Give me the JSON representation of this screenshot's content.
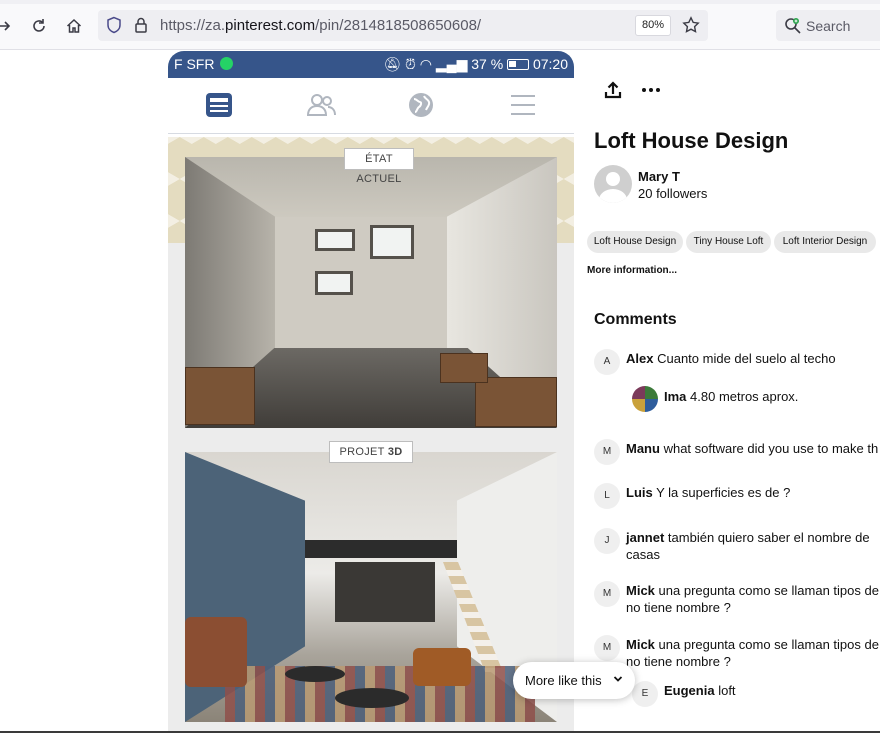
{
  "browser": {
    "url_prefix": "https://za.",
    "url_domain": "pinterest.com",
    "url_path": "/pin/2814818508650608/",
    "zoom": "80%",
    "search_label": "Search"
  },
  "phone_status": {
    "carrier": "F SFR",
    "battery": "37 %",
    "time": "07:20"
  },
  "pin_image": {
    "label_before": "ÉTAT ACTUEL",
    "label_after_prefix": "PROJET ",
    "label_after_bold": "3D"
  },
  "pin": {
    "title": "Loft House Design",
    "user_name": "Mary T",
    "followers": "20 followers",
    "tags": [
      "Loft House Design",
      "Tiny House Loft",
      "Loft Interior Design"
    ],
    "more_info": "More information..."
  },
  "comments_heading": "Comments",
  "comments": [
    {
      "initial": "A",
      "author": "Alex",
      "text": "Cuanto mide del suelo al techo",
      "text2": ""
    },
    {
      "initial": "",
      "author": "Ima",
      "text": "4.80 metros aprox.",
      "text2": ""
    },
    {
      "initial": "M",
      "author": "Manu",
      "text": "what software did you use to make th",
      "text2": ""
    },
    {
      "initial": "L",
      "author": "Luis",
      "text": "Y la superficies es de ?",
      "text2": ""
    },
    {
      "initial": "J",
      "author": "jannet",
      "text": "también quiero saber el nombre de",
      "text2": "casas"
    },
    {
      "initial": "M",
      "author": "Mick",
      "text": "una pregunta como se llaman tipos de",
      "text2": "no tiene nombre ?"
    },
    {
      "initial": "M",
      "author": "Mick",
      "text": "una pregunta como se llaman tipos de",
      "text2": "no tiene nombre ?"
    },
    {
      "initial": "E",
      "author": "Eugenia",
      "text": "loft",
      "text2": ""
    }
  ],
  "more_like_this": "More like this",
  "colors": {
    "fb_blue": "#36558a",
    "tag_bg": "#e9e9e9"
  }
}
